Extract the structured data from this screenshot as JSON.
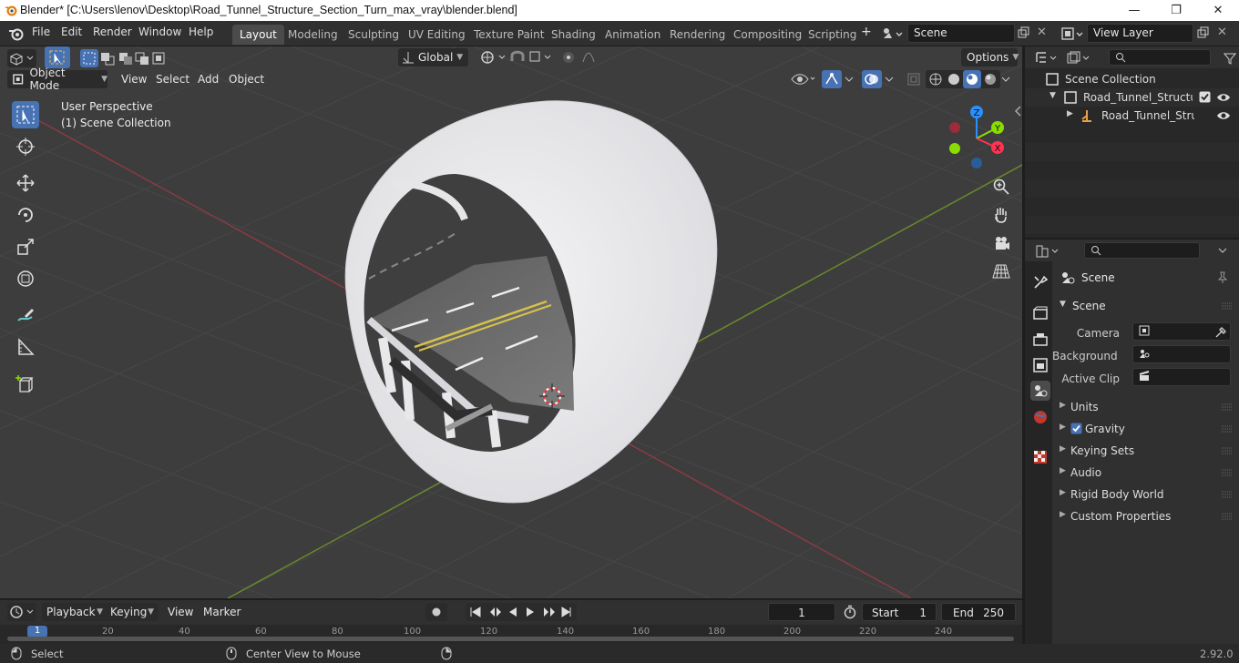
{
  "window": {
    "title": "Blender* [C:\\Users\\lenov\\Desktop\\Road_Tunnel_Structure_Section_Turn_max_vray\\blender.blend]",
    "minimize": "—",
    "maximize": "❐",
    "close": "✕"
  },
  "menubar": {
    "items": [
      "File",
      "Edit",
      "Render",
      "Window",
      "Help"
    ]
  },
  "workspaces": {
    "tabs": [
      "Layout",
      "Modeling",
      "Sculpting",
      "UV Editing",
      "Texture Paint",
      "Shading",
      "Animation",
      "Rendering",
      "Compositing",
      "Scripting"
    ],
    "active": "Layout",
    "add": "+"
  },
  "scene_selector": {
    "value": "Scene"
  },
  "view_layer_selector": {
    "value": "View Layer"
  },
  "viewport_header": {
    "transform_orientation": "Global",
    "options": "Options",
    "mode": "Object Mode",
    "menus": [
      "View",
      "Select",
      "Add",
      "Object"
    ]
  },
  "viewport": {
    "perspective_label": "User Perspective",
    "collection_label": "(1) Scene Collection",
    "gizmo": {
      "x": "X",
      "y": "Y",
      "z": "Z"
    }
  },
  "outliner": {
    "root": "Scene Collection",
    "items": [
      {
        "label": "Road_Tunnel_Structure_S"
      },
      {
        "label": "Road_Tunnel_Structu"
      }
    ]
  },
  "properties": {
    "context": "Scene",
    "panel_title": "Scene",
    "fields": [
      {
        "label": "Camera"
      },
      {
        "label": "Background ..."
      },
      {
        "label": "Active Clip"
      }
    ],
    "panels": [
      "Units",
      "Gravity",
      "Keying Sets",
      "Audio",
      "Rigid Body World",
      "Custom Properties"
    ],
    "gravity_checked": true
  },
  "timeline": {
    "menus": [
      "Playback",
      "Keying",
      "View",
      "Marker"
    ],
    "current_frame": "1",
    "start_label": "Start",
    "start_value": "1",
    "end_label": "End",
    "end_value": "250",
    "ruler": [
      "1",
      "20",
      "40",
      "60",
      "80",
      "100",
      "120",
      "140",
      "160",
      "180",
      "200",
      "220",
      "240"
    ]
  },
  "statusbar": {
    "left": "Select",
    "middle": "Center View to Mouse",
    "version": "2.92.0"
  },
  "colors": {
    "accent_blue": "#4772b3",
    "x_axis": "#ff3352",
    "y_axis": "#8bdc00",
    "z_axis": "#2890ff",
    "grid": "#464646"
  }
}
